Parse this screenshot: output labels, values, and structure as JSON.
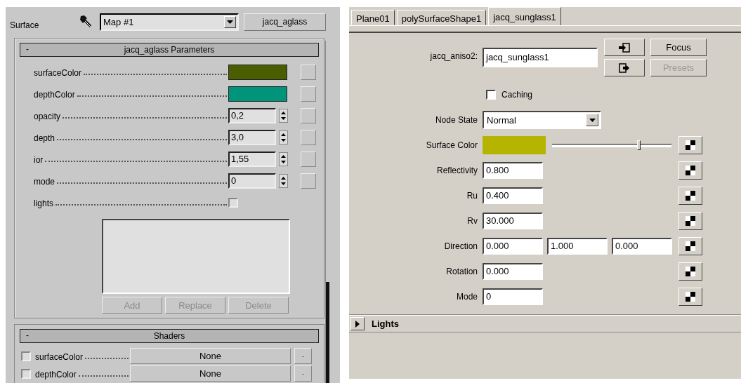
{
  "left_panel": {
    "surface_label": "Surface",
    "map_dropdown": {
      "value": "Map #1"
    },
    "material_button": "jacq_aglass",
    "parameters_rollout": {
      "collapse_symbol": "-",
      "title": "jacq_aglass Parameters",
      "params": [
        {
          "label": "surfaceColor",
          "kind": "color",
          "color": "#4a5e00"
        },
        {
          "label": "depthColor",
          "kind": "color",
          "color": "#00947a"
        },
        {
          "label": "opacity",
          "kind": "spinner",
          "value": "0,2"
        },
        {
          "label": "depth",
          "kind": "spinner",
          "value": "3,0"
        },
        {
          "label": "ior",
          "kind": "spinner",
          "value": "1,55"
        },
        {
          "label": "mode",
          "kind": "spinner",
          "value": "0"
        },
        {
          "label": "lights",
          "kind": "checkbox",
          "checked": false
        }
      ],
      "list_buttons": [
        {
          "label": "Add",
          "disabled": true
        },
        {
          "label": "Replace",
          "disabled": true
        },
        {
          "label": "Delete",
          "disabled": true
        }
      ]
    },
    "shaders_rollout": {
      "collapse_symbol": "-",
      "title": "Shaders",
      "rows": [
        {
          "label": "surfaceColor",
          "checked": false,
          "map": "None",
          "remove": "-"
        },
        {
          "label": "depthColor",
          "checked": false,
          "map": "None",
          "remove": "-"
        }
      ]
    }
  },
  "right_panel": {
    "tabs": [
      {
        "label": "Plane01",
        "selected": false
      },
      {
        "label": "polySurfaceShape1",
        "selected": false
      },
      {
        "label": "jacq_sunglass1",
        "selected": true
      }
    ],
    "node_name": {
      "label": "jacq_aniso2:",
      "value": "jacq_sunglass1"
    },
    "side_buttons": [
      {
        "label": "Focus",
        "disabled": false
      },
      {
        "label": "Presets",
        "disabled": true
      }
    ],
    "caching": {
      "label": "Caching",
      "checked": false
    },
    "node_state": {
      "label": "Node State",
      "value": "Normal"
    },
    "attributes": [
      {
        "label": "Surface Color",
        "kind": "color",
        "color": "#b5b400",
        "level": 0.73
      },
      {
        "label": "Reflectivity",
        "kind": "field",
        "values": [
          "0.800"
        ]
      },
      {
        "label": "Ru",
        "kind": "field",
        "values": [
          "0.400"
        ]
      },
      {
        "label": "Rv",
        "kind": "field",
        "values": [
          "30.000"
        ]
      },
      {
        "label": "Direction",
        "kind": "field",
        "values": [
          "0.000",
          "1.000",
          "0.000"
        ]
      },
      {
        "label": "Rotation",
        "kind": "field",
        "values": [
          "0.000"
        ]
      },
      {
        "label": "Mode",
        "kind": "field",
        "values": [
          "0"
        ]
      }
    ],
    "lights_section": {
      "label": "Lights",
      "expanded": false
    }
  }
}
